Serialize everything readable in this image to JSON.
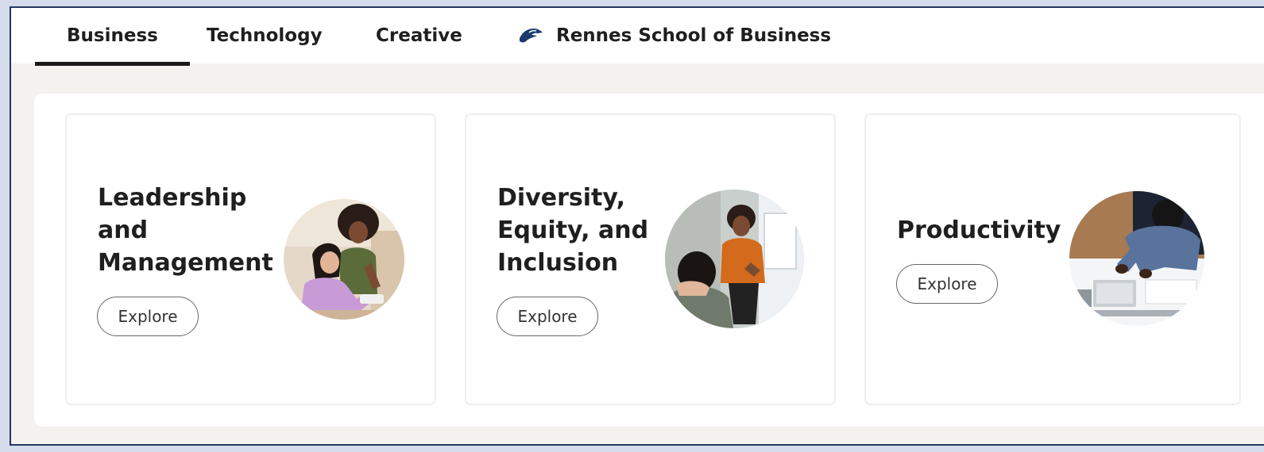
{
  "tabs": [
    {
      "label": "Business",
      "active": true
    },
    {
      "label": "Technology",
      "active": false
    },
    {
      "label": "Creative",
      "active": false
    },
    {
      "label": "Rennes School of Business",
      "active": false,
      "icon": "rennes-logo-icon"
    }
  ],
  "cards": [
    {
      "title": "Leadership\nand\nManagement",
      "button_label": "Explore",
      "image": "leadership-photo"
    },
    {
      "title": "Diversity,\nEquity, and\nInclusion",
      "button_label": "Explore",
      "image": "diversity-photo"
    },
    {
      "title": "Productivity",
      "button_label": "Explore",
      "image": "productivity-photo"
    }
  ],
  "colors": {
    "background": "#f3f2ef",
    "active_tab_underline": "#191919",
    "frame_accent": "#23365e",
    "rennes_logo": "#1c3a6e"
  }
}
